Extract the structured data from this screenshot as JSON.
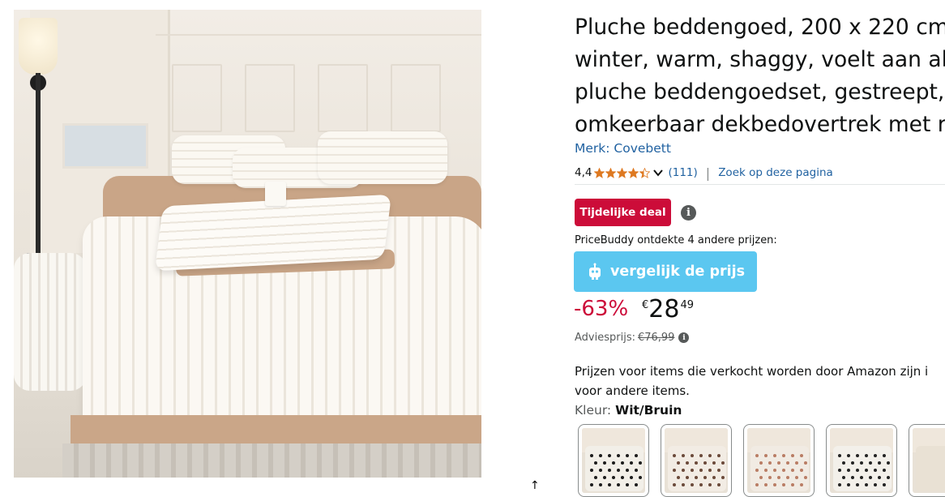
{
  "product": {
    "title_lines": [
      "Pluche beddengoed, 200 x 220 cm",
      "winter, warm, shaggy, voelt aan al",
      "pluche beddengoedset, gestreept,",
      "omkeerbaar dekbedovertrek met r"
    ],
    "brand": "Merk: Covebett",
    "rating_value": "4,4",
    "rating_stars": 4.4,
    "rating_count": "(111)",
    "search_link": "Zoek op deze pagina",
    "deal_badge": "Tijdelijke deal",
    "info_icon_glyph": "i",
    "pricebuddy_note": "PriceBuddy ontdekte 4 andere prijzen:",
    "compare_button": "vergelijk de prijs",
    "discount": "-63%",
    "price_symbol": "€",
    "price_whole": "28",
    "price_fraction": "49",
    "list_price_label": "Adviesprijs:",
    "list_price_value": "€76,99",
    "prices_note_lines": [
      "Prijzen voor items die verkocht worden door Amazon zijn i",
      "voor andere items."
    ],
    "color_label": "Kleur:",
    "color_value": "Wit/Bruin"
  },
  "swatches": [
    {
      "name": "wit-zwart-harten",
      "bed_color": "#f2efe8",
      "dot_color": "#1c1c1c"
    },
    {
      "name": "wit-bruin-harten",
      "bed_color": "#f2ece4",
      "dot_color": "#6b4a3a"
    },
    {
      "name": "wit-roze-harten",
      "bed_color": "#f1ebe3",
      "dot_color": "#b97d64"
    },
    {
      "name": "zwart-wit-harten",
      "bed_color": "#f3f0ea",
      "dot_color": "#232323"
    },
    {
      "name": "beige-effen",
      "bed_color": "#e9e1d4",
      "dot_color": "#e9e1d4"
    }
  ],
  "colors": {
    "accent_link": "#2162a1",
    "deal_red": "#cc0c39",
    "compare_blue": "#5bc7f0",
    "star_orange": "#de7921"
  },
  "icons": {
    "cursor": "up-arrow-cursor-icon",
    "robot": "robot-icon",
    "info": "info-icon"
  }
}
